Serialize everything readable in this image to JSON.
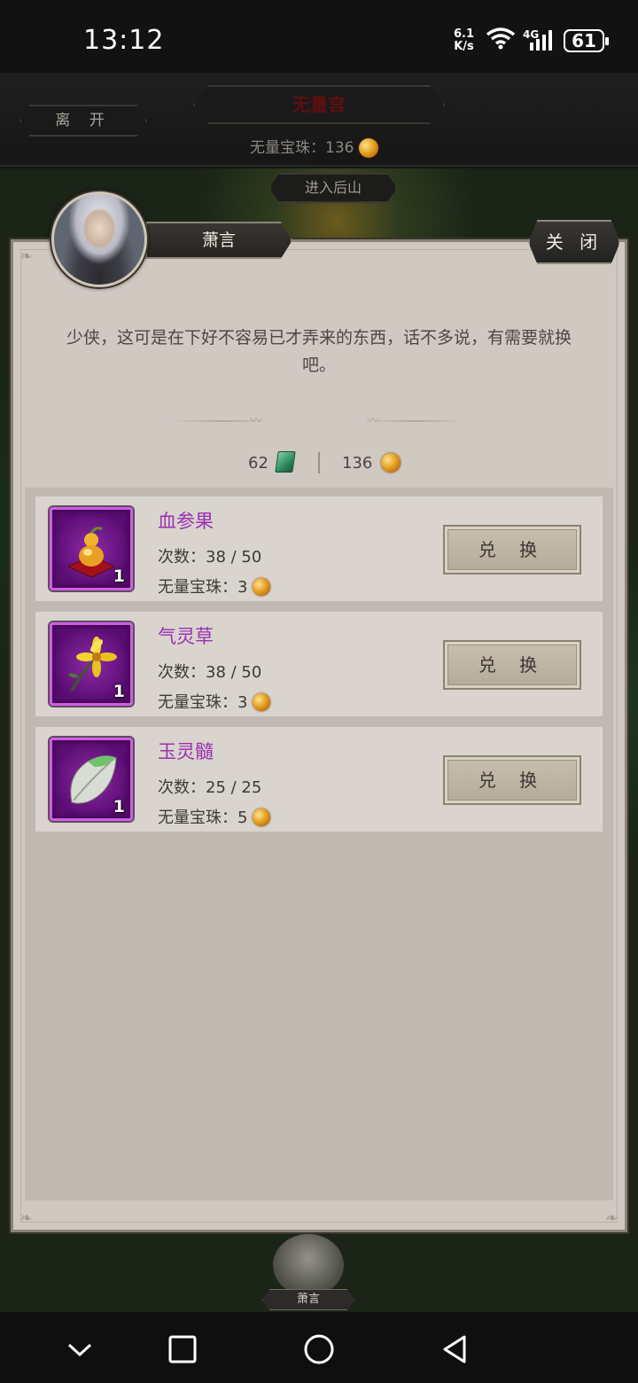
{
  "status_bar": {
    "time": "13:12",
    "net_speed_value": "6.1",
    "net_speed_unit": "K/s",
    "network": "4G",
    "battery": "61"
  },
  "header": {
    "leave_label": "离 开",
    "title": "无量宫",
    "pearl_label": "无量宝珠：136"
  },
  "scene": {
    "enter_label": "进入后山",
    "npc_label": "萧言"
  },
  "dialog": {
    "npc_name": "萧言",
    "close_label": "关 闭",
    "text": "少侠，这可是在下好不容易已才弄来的东西，话不多说，有需要就换吧。",
    "jade_amount": "62",
    "pearl_amount": "136"
  },
  "items": [
    {
      "name": "血参果",
      "count": "次数：38 / 50",
      "cost": "无量宝珠：3",
      "qty": "1",
      "button": "兑 换",
      "icon": "gourd-icon"
    },
    {
      "name": "气灵草",
      "count": "次数：38 / 50",
      "cost": "无量宝珠：3",
      "qty": "1",
      "button": "兑 换",
      "icon": "flower-icon"
    },
    {
      "name": "玉灵髓",
      "count": "次数：25 / 25",
      "cost": "无量宝珠：5",
      "qty": "1",
      "button": "兑 换",
      "icon": "jade-leaf-icon"
    }
  ],
  "colors": {
    "item_name": "#9b2fb3",
    "item_frame": "#d35be6",
    "dialog_bg": "#cfc9c2"
  }
}
